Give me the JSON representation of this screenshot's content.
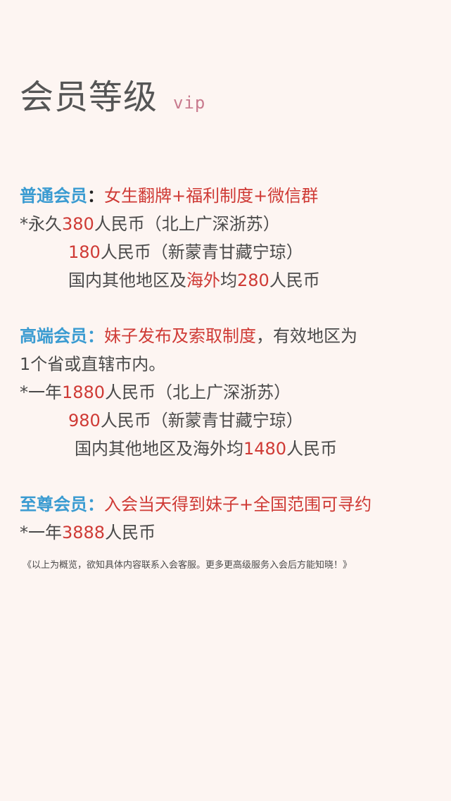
{
  "header": {
    "title": "会员等级",
    "subtitle": "vip"
  },
  "normal": {
    "name": "普通会员",
    "colon": "：",
    "benefits": "女生翻牌+福利制度+微信群",
    "l1_prefix": "*永久",
    "l1_price": "380",
    "l1_suffix": "人民币（北上广深浙苏）",
    "l2_price": "180",
    "l2_suffix": "人民币（新蒙青甘藏宁琼）",
    "l3_prefix": "国内其他地区及",
    "l3_red": "海外",
    "l3_mid": "均",
    "l3_price": "280",
    "l3_suffix": "人民币"
  },
  "high": {
    "name": "高端会员",
    "colon": "：",
    "benefits": "妹子发布及索取制度",
    "desc": "，有效地区为",
    "desc2": "1个省或直辖市内。",
    "l1_prefix": "*一年",
    "l1_price": "1880",
    "l1_suffix": "人民币（北上广深浙苏）",
    "l2_price": "980",
    "l2_suffix": "人民币（新蒙青甘藏宁琼）",
    "l3_prefix": "国内其他地区及海外均",
    "l3_price": "1480",
    "l3_suffix": "人民币"
  },
  "supreme": {
    "name": "至尊会员",
    "colon": "：",
    "benefits": "入会当天得到妹子+全国范围可寻约",
    "l1_prefix": "*一年",
    "l1_price": "3888",
    "l1_suffix": "人民币"
  },
  "footer": {
    "note": "《以上为概览，欲知具体内容联系入会客服。更多更高级服务入会后方能知晓！》"
  }
}
